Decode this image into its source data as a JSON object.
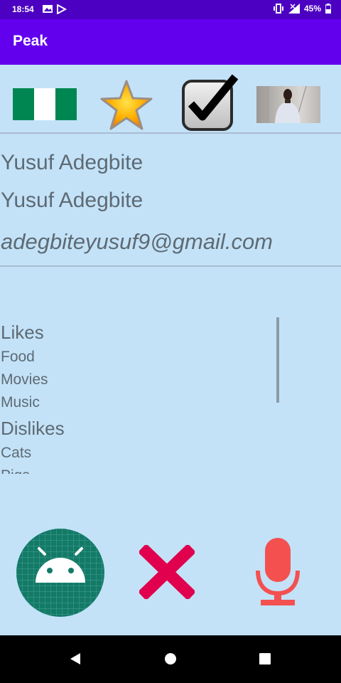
{
  "status_bar": {
    "time": "18:54",
    "battery_percent": "45%"
  },
  "app_bar": {
    "title": "Peak"
  },
  "top_icons": {
    "flag": "nigeria-flag",
    "star": "star-icon",
    "check": "checkbox-checked-icon",
    "photo": "profile-photo"
  },
  "profile": {
    "name_line_1": "Yusuf Adegbite",
    "name_line_2": "Yusuf Adegbite",
    "email": "adegbiteyusuf9@gmail.com"
  },
  "preferences": {
    "likes_header": "Likes",
    "likes": [
      "Food",
      "Movies",
      "Music"
    ],
    "dislikes_header": "Dislikes",
    "dislikes": [
      "Cats",
      "Pigs"
    ]
  },
  "bottom_buttons": {
    "android": "android-icon",
    "close": "close-icon",
    "mic": "microphone-icon"
  },
  "colors": {
    "status_bar": "#4c00c2",
    "app_bar": "#6200ee",
    "background": "#c3e2f8",
    "text": "#5e6a73"
  }
}
